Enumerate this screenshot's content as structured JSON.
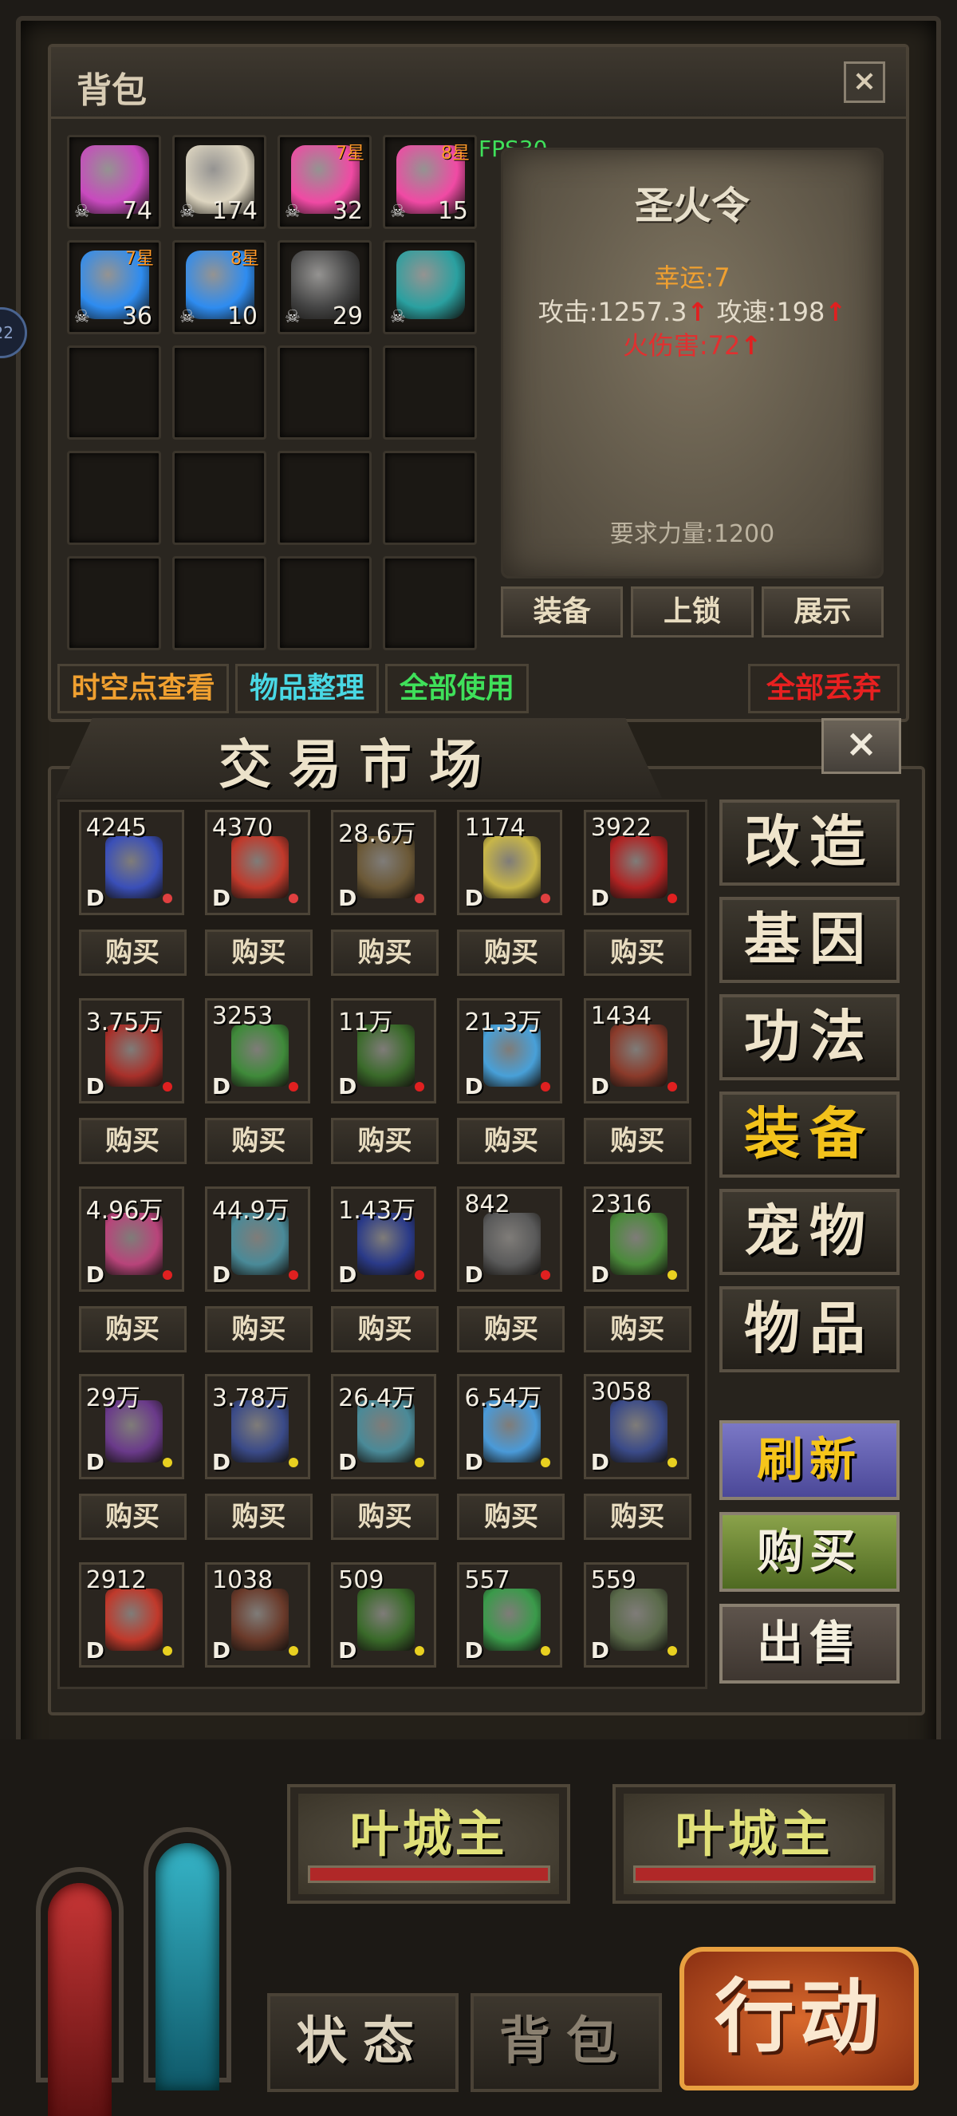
{
  "bag": {
    "title": "背包",
    "close_label": "×",
    "fps": "FPS30",
    "slots": [
      {
        "name": "pink-tool",
        "qty": "74",
        "star": "",
        "color": "#c84abe"
      },
      {
        "name": "paper-pack",
        "qty": "174",
        "star": "",
        "color": "#ddd5c0"
      },
      {
        "name": "pink-gem",
        "qty": "32",
        "star": "7星",
        "color": "#f04aa4"
      },
      {
        "name": "pink-gem",
        "qty": "15",
        "star": "8星",
        "color": "#f04aa4"
      },
      {
        "name": "blue-gem",
        "qty": "36",
        "star": "7星",
        "color": "#2e8cf0"
      },
      {
        "name": "blue-gem",
        "qty": "10",
        "star": "8星",
        "color": "#2e8cf0"
      },
      {
        "name": "camera",
        "qty": "29",
        "star": "",
        "color": "#444"
      },
      {
        "name": "flame-token",
        "qty": "",
        "star": "",
        "color": "#2aa0a0"
      }
    ],
    "tooltip": {
      "name": "圣火令",
      "luck": "幸运:7",
      "attack": "攻击:1257.3",
      "speed": "攻速:198",
      "fire": "火伤害:72",
      "requirement": "要求力量:1200",
      "up_arrow": "↑"
    },
    "tooltip_buttons": [
      "装备",
      "上锁",
      "展示"
    ],
    "actions": [
      {
        "label": "时空点查看",
        "color": "#f0a030"
      },
      {
        "label": "物品整理",
        "color": "#49d8e4"
      },
      {
        "label": "全部使用",
        "color": "#3fe05a"
      },
      {
        "label": "全部丢弃",
        "color": "#e82020"
      }
    ]
  },
  "market": {
    "title": "交易市场",
    "close_label": "×",
    "buy_label": "购买",
    "items": [
      {
        "price": "4245",
        "grade": "D",
        "dot": "#e04040",
        "color": "#3a4fb8"
      },
      {
        "price": "4370",
        "grade": "D",
        "dot": "#e04040",
        "color": "#c0392b"
      },
      {
        "price": "28.6万",
        "grade": "D",
        "dot": "#e04040",
        "color": "#6b5836"
      },
      {
        "price": "1174",
        "grade": "D",
        "dot": "#e04040",
        "color": "#c8b648"
      },
      {
        "price": "3922",
        "grade": "D",
        "dot": "#e02020",
        "color": "#b02222"
      },
      {
        "price": "3.75万",
        "grade": "D",
        "dot": "#e02020",
        "color": "#a8302a"
      },
      {
        "price": "3253",
        "grade": "D",
        "dot": "#e02020",
        "color": "#3f8a3a"
      },
      {
        "price": "11万",
        "grade": "D",
        "dot": "#e02020",
        "color": "#3a6a2a"
      },
      {
        "price": "21.3万",
        "grade": "D",
        "dot": "#e02020",
        "color": "#48a0d8"
      },
      {
        "price": "1434",
        "grade": "D",
        "dot": "#e02020",
        "color": "#8a3a2a"
      },
      {
        "price": "4.96万",
        "grade": "D",
        "dot": "#e02020",
        "color": "#b8447a"
      },
      {
        "price": "44.9万",
        "grade": "D",
        "dot": "#e02020",
        "color": "#4a8a98"
      },
      {
        "price": "1.43万",
        "grade": "D",
        "dot": "#e02020",
        "color": "#2a3a88"
      },
      {
        "price": "842",
        "grade": "D",
        "dot": "#e02020",
        "color": "#5a5a5a"
      },
      {
        "price": "2316",
        "grade": "D",
        "dot": "#e8d020",
        "color": "#4a8a3a"
      },
      {
        "price": "29万",
        "grade": "D",
        "dot": "#e8d020",
        "color": "#6a3a8a"
      },
      {
        "price": "3.78万",
        "grade": "D",
        "dot": "#e8d020",
        "color": "#3a4a88"
      },
      {
        "price": "26.4万",
        "grade": "D",
        "dot": "#e8d020",
        "color": "#4a8a98"
      },
      {
        "price": "6.54万",
        "grade": "D",
        "dot": "#e8d020",
        "color": "#4a9ad8"
      },
      {
        "price": "3058",
        "grade": "D",
        "dot": "#e8d020",
        "color": "#3a4a88"
      },
      {
        "price": "2912",
        "grade": "D",
        "dot": "#e8d020",
        "color": "#c0392b"
      },
      {
        "price": "1038",
        "grade": "D",
        "dot": "#e8d020",
        "color": "#6a3a2a"
      },
      {
        "price": "509",
        "grade": "D",
        "dot": "#e8d020",
        "color": "#3a6a2a"
      },
      {
        "price": "557",
        "grade": "D",
        "dot": "#e8d020",
        "color": "#3a9a4a"
      },
      {
        "price": "559",
        "grade": "D",
        "dot": "#e8d020",
        "color": "#5a6a4a"
      }
    ],
    "categories": [
      "改造",
      "基因",
      "功法",
      "装备",
      "宠物",
      "物品"
    ],
    "active_category": "装备",
    "refresh_label": "刷新",
    "buy_big_label": "购买",
    "sell_label": "出售"
  },
  "hud": {
    "target_left": "叶城主",
    "target_right": "叶城主",
    "tab_status": "状态",
    "tab_bag": "背包",
    "action_label": "行动",
    "side_chip": "22"
  }
}
